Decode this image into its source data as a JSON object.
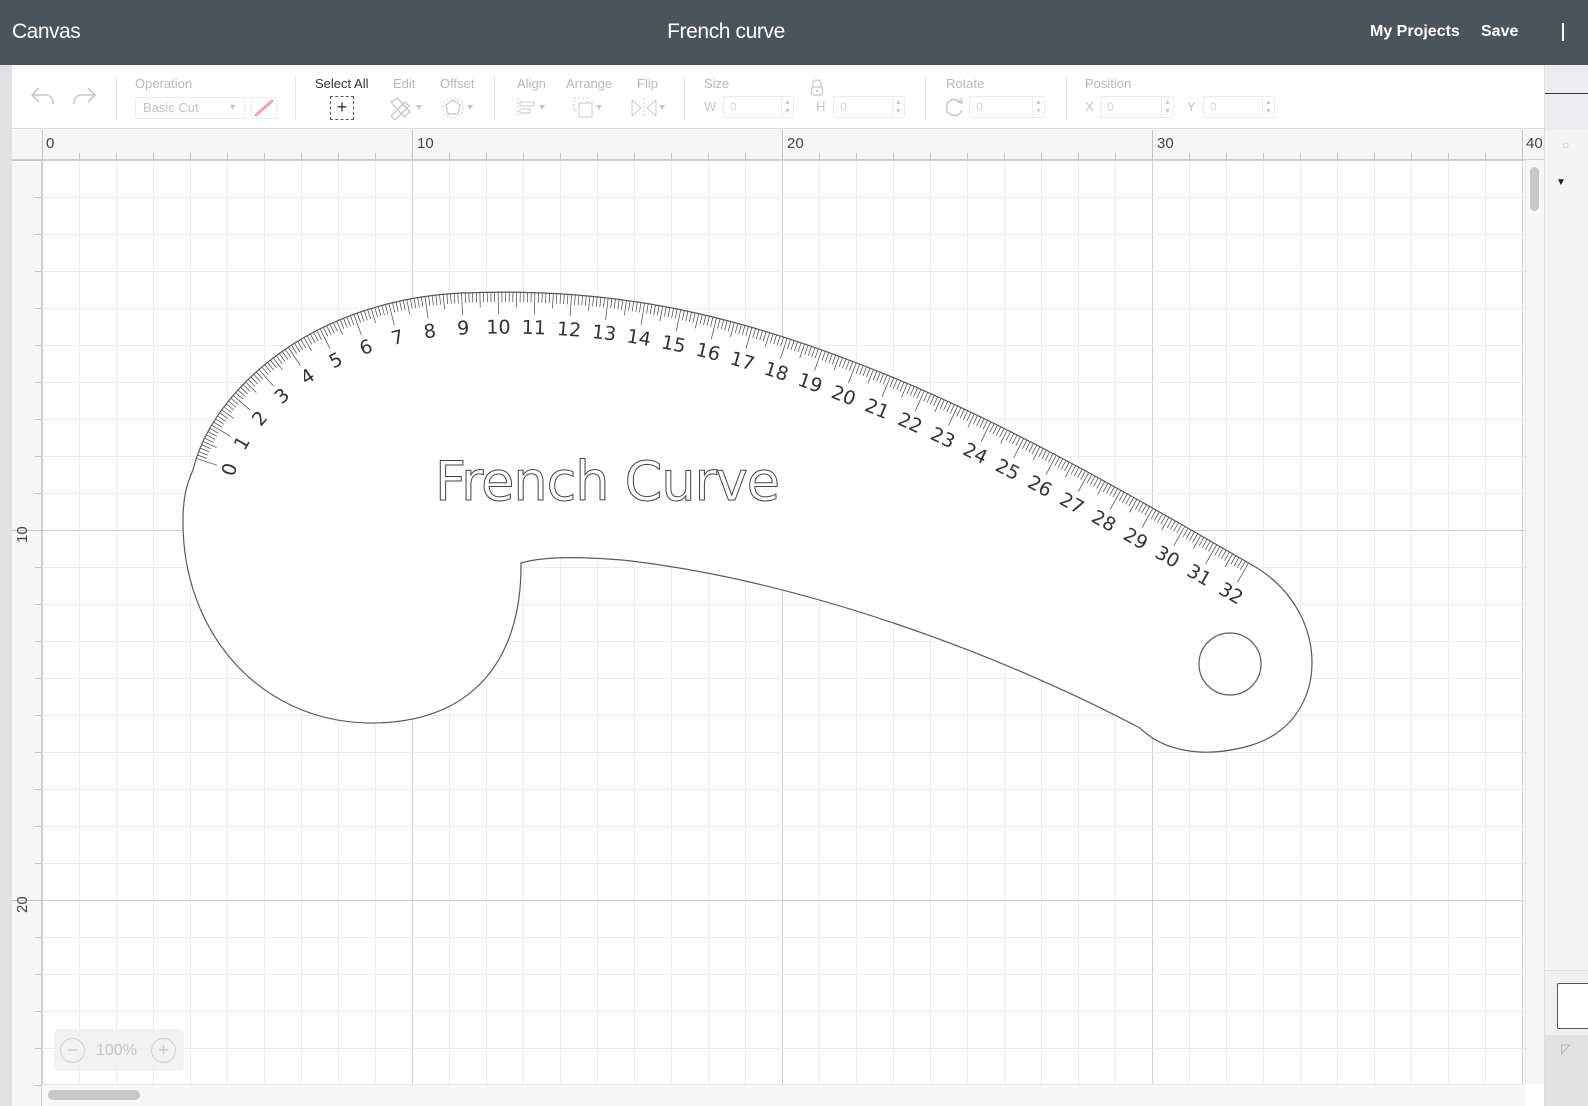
{
  "header": {
    "app_title": "Canvas",
    "document_title": "French curve",
    "my_projects_label": "My Projects",
    "save_label": "Save"
  },
  "toolbar": {
    "undo_icon": "undo-arrow-icon",
    "redo_icon": "redo-arrow-icon",
    "operation": {
      "label": "Operation",
      "value": "Basic Cut",
      "color_swatch": "#f0a0ae"
    },
    "select_all_label": "Select All",
    "edit_label": "Edit",
    "offset_label": "Offset",
    "align_label": "Align",
    "arrange_label": "Arrange",
    "flip_label": "Flip",
    "size": {
      "label": "Size",
      "w_label": "W",
      "w_value": "0",
      "h_label": "H",
      "h_value": "0"
    },
    "rotate": {
      "label": "Rotate",
      "value": "0"
    },
    "position": {
      "label": "Position",
      "x_label": "X",
      "x_value": "0",
      "y_label": "Y",
      "y_value": "0"
    }
  },
  "rulers": {
    "horizontal": [
      "0",
      "10",
      "20",
      "30",
      "40"
    ],
    "vertical": [
      "10",
      "20"
    ]
  },
  "canvas": {
    "design_title": "French Curve",
    "scale_numbers": [
      "0",
      "1",
      "2",
      "3",
      "4",
      "5",
      "6",
      "7",
      "8",
      "9",
      "10",
      "11",
      "12",
      "13",
      "14",
      "15",
      "16",
      "17",
      "18",
      "19",
      "20",
      "21",
      "22",
      "23",
      "24",
      "25",
      "26",
      "27",
      "28",
      "29",
      "30",
      "31",
      "32"
    ]
  },
  "zoom": {
    "value": "100%",
    "minus": "−",
    "plus": "+"
  },
  "colors": {
    "header_bg": "#4a545d",
    "accent_swatch": "#f0a0ae",
    "outline": "#555555"
  }
}
